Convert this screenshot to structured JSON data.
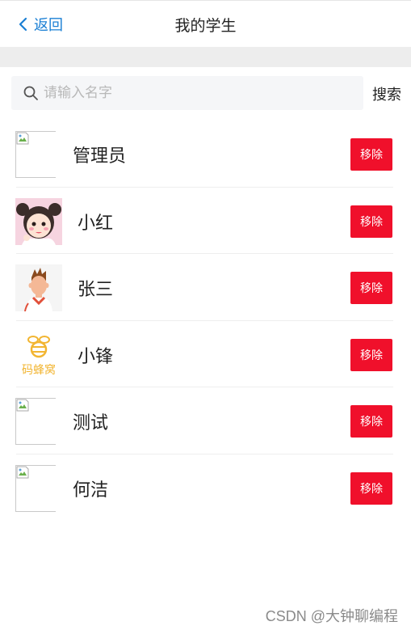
{
  "nav": {
    "back_label": "返回",
    "title": "我的学生"
  },
  "search": {
    "placeholder": "请输入名字",
    "value": "",
    "button_label": "搜索"
  },
  "students": [
    {
      "name": "管理员",
      "avatar": "broken-image-icon",
      "action_label": "移除"
    },
    {
      "name": "小红",
      "avatar": "girl-avatar",
      "action_label": "移除"
    },
    {
      "name": "张三",
      "avatar": "boy-avatar",
      "action_label": "移除"
    },
    {
      "name": "小锋",
      "avatar": "bee-logo",
      "avatar_logo_text": "码蜂窝",
      "action_label": "移除"
    },
    {
      "name": "测试",
      "avatar": "broken-image-icon",
      "action_label": "移除"
    },
    {
      "name": "何洁",
      "avatar": "broken-image-icon",
      "action_label": "移除"
    }
  ],
  "watermark": "CSDN @大钟聊编程",
  "colors": {
    "accent": "#1a7fd4",
    "danger": "#f0102b",
    "divider": "#ededed"
  }
}
